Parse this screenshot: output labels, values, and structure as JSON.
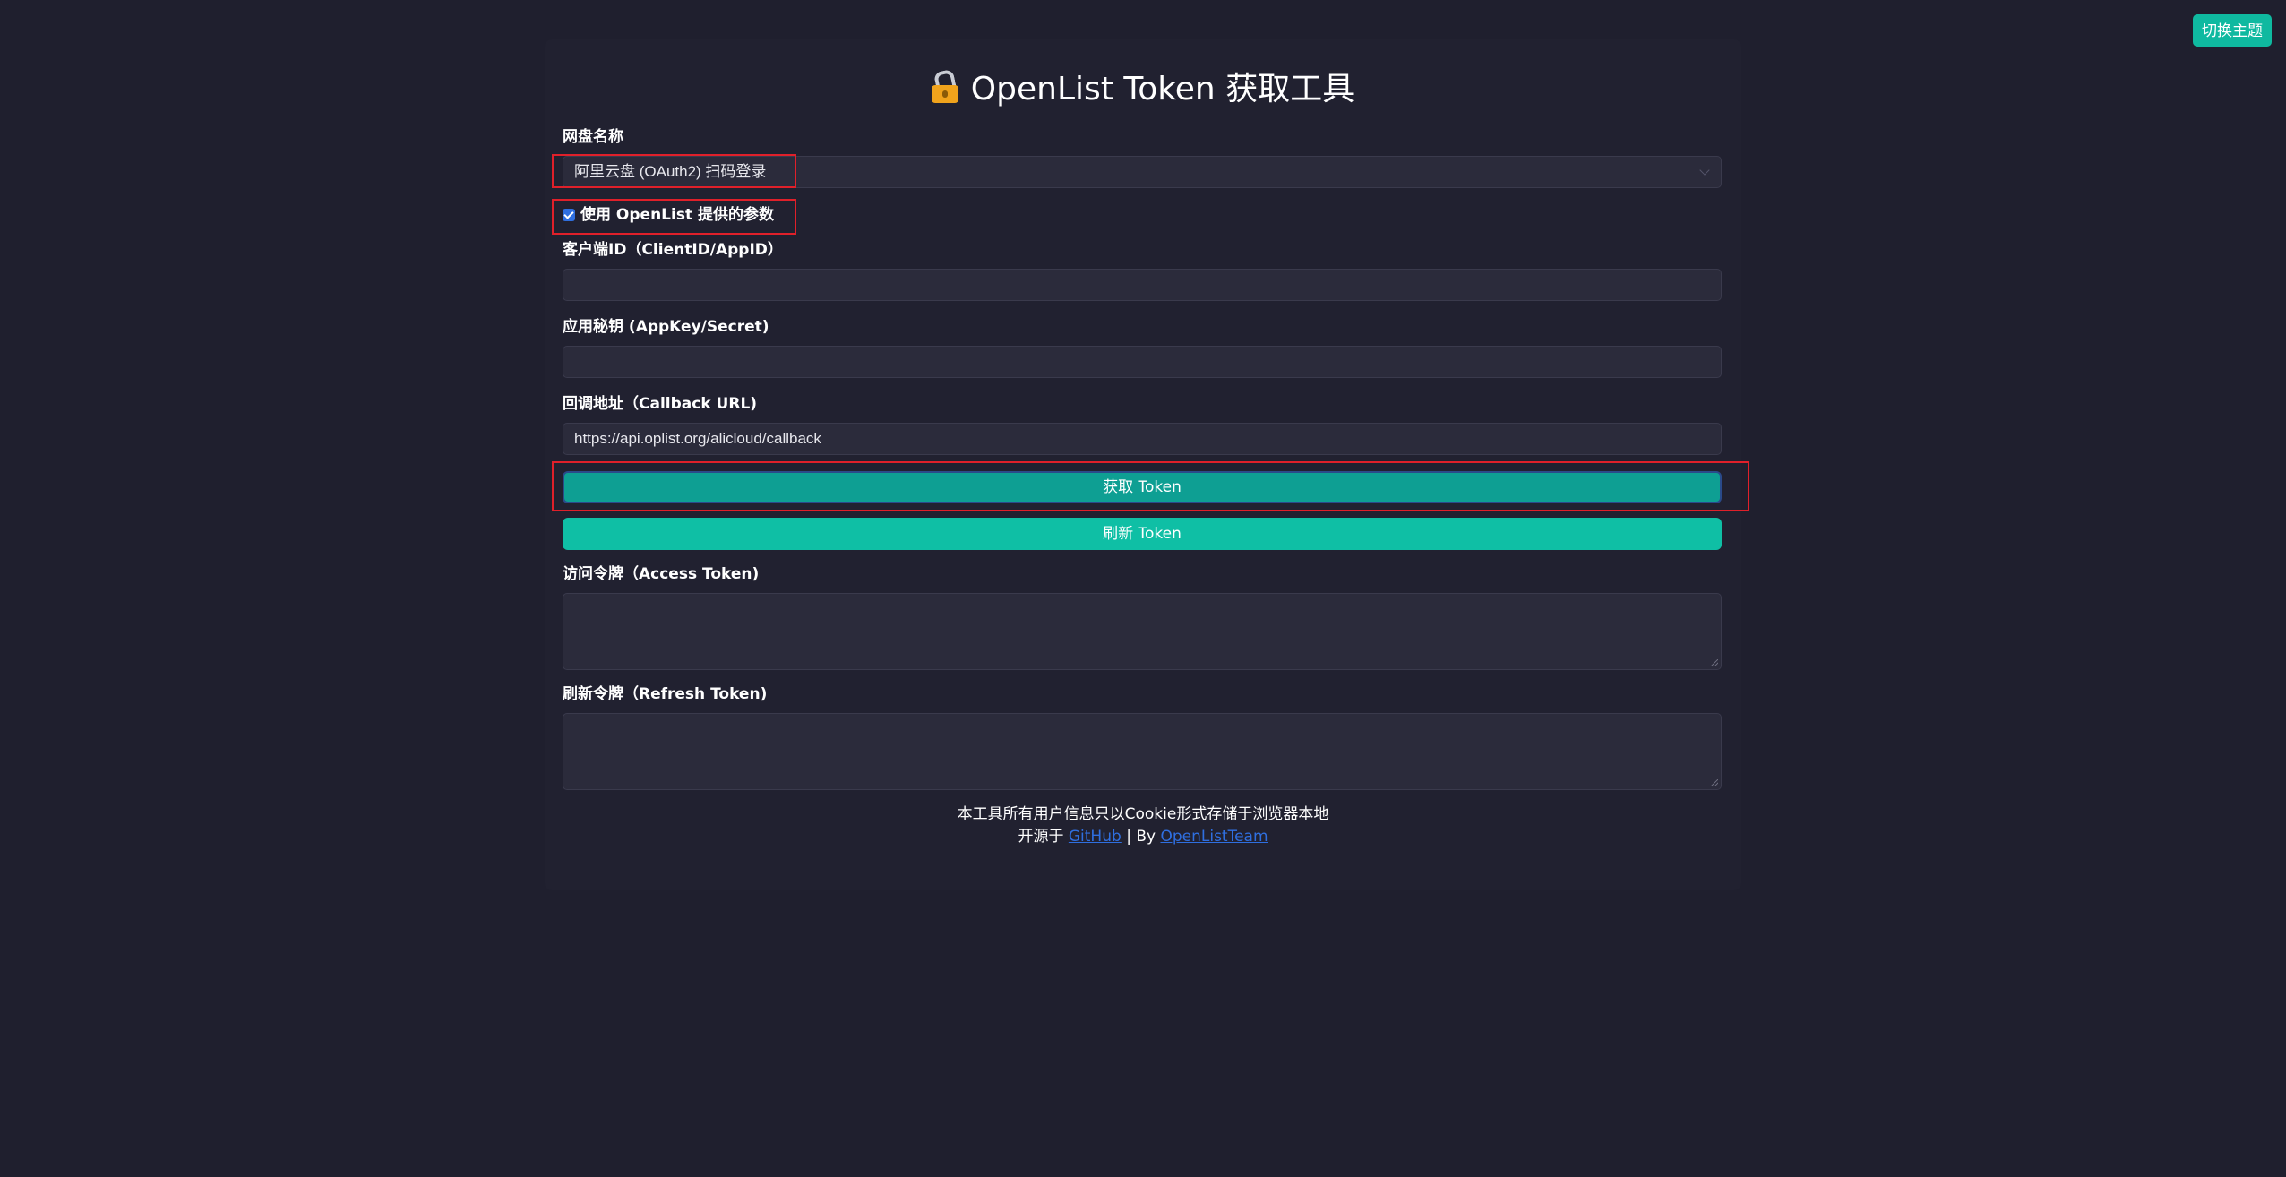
{
  "header": {
    "theme_button": "切换主题",
    "title": "OpenList Token 获取工具",
    "title_icon": "lock-icon"
  },
  "form": {
    "drive_label": "网盘名称",
    "drive_selected": "阿里云盘 (OAuth2) 扫码登录",
    "use_params_label": "使用 OpenList 提供的参数",
    "use_params_checked": true,
    "client_id_label": "客户端ID（ClientID/AppID）",
    "client_id_value": "",
    "secret_label": "应用秘钥 (AppKey/Secret)",
    "secret_value": "",
    "callback_label": "回调地址（Callback URL)",
    "callback_value": "https://api.oplist.org/alicloud/callback",
    "get_token_button": "获取 Token",
    "refresh_token_button": "刷新 Token",
    "access_token_label": "访问令牌（Access Token)",
    "refresh_token_label": "刷新令牌（Refresh Token)"
  },
  "footer": {
    "notice": "本工具所有用户信息只以Cookie形式存储于浏览器本地",
    "open_source_prefix": "开源于",
    "github_link": "GitHub",
    "separator": "| By",
    "team_link": "OpenListTeam"
  },
  "colors": {
    "background": "#1f1f2e",
    "accent": "#0fbfa5",
    "primary_button": "#0e9f93",
    "link": "#2f6fe0",
    "highlight_box": "#e0202a"
  }
}
